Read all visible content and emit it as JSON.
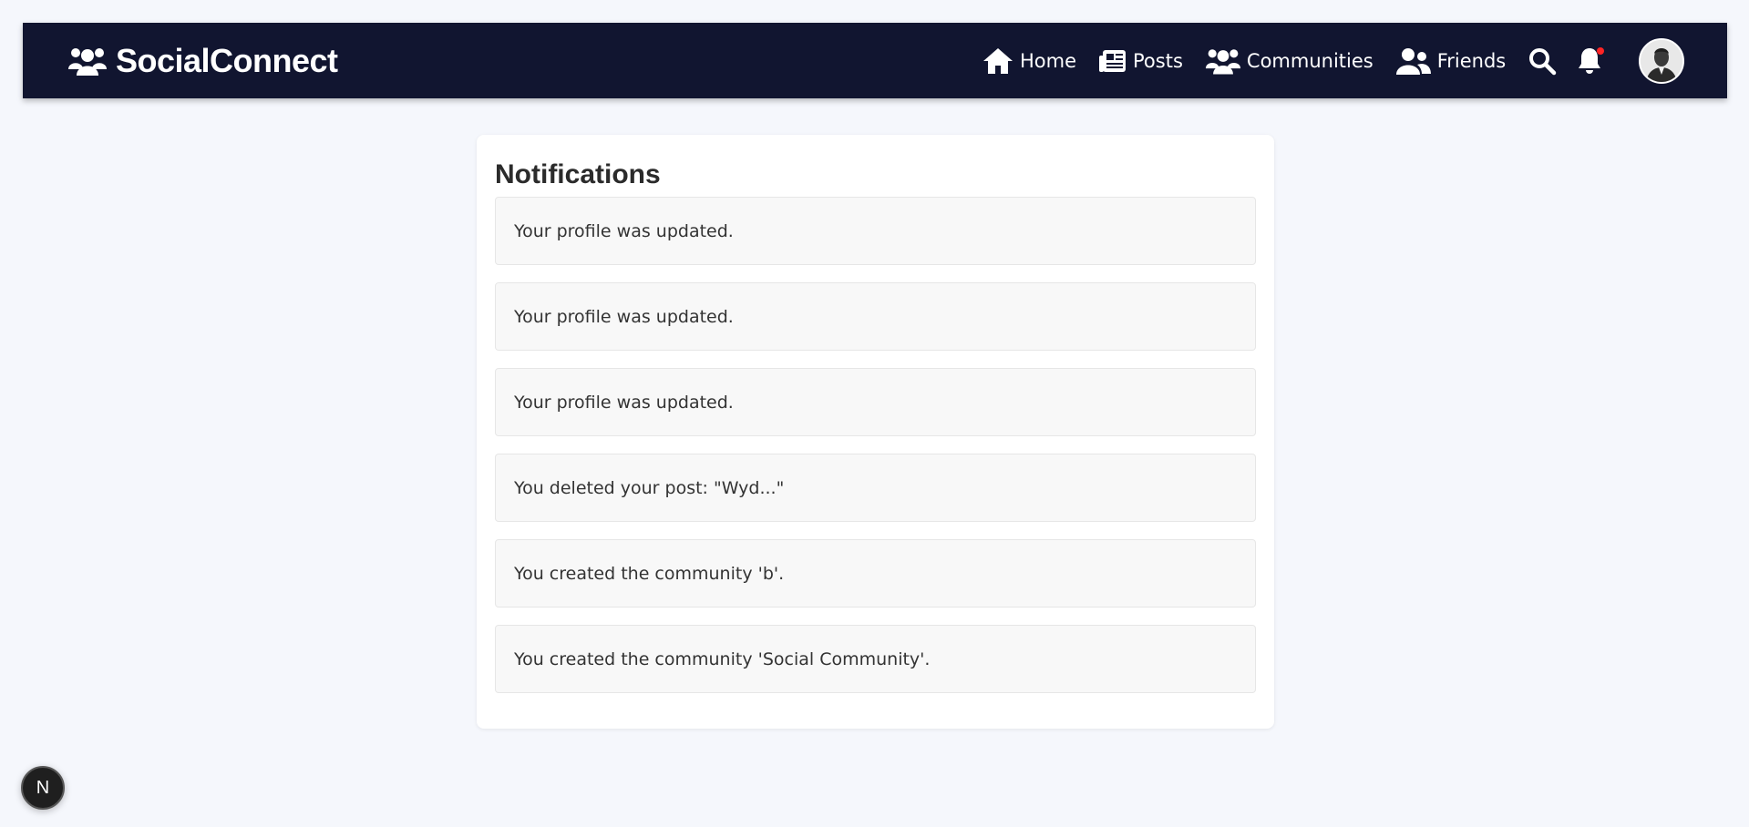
{
  "header": {
    "brand": "SocialConnect",
    "brand_icon": "users-icon",
    "nav": [
      {
        "label": "Home",
        "icon": "home-icon"
      },
      {
        "label": "Posts",
        "icon": "newspaper-icon"
      },
      {
        "label": "Communities",
        "icon": "users-icon"
      },
      {
        "label": "Friends",
        "icon": "user-friends-icon"
      }
    ],
    "search_icon": "search-icon",
    "notification_icon": "bell-icon",
    "notification_has_unread": true,
    "avatar_icon": "avatar"
  },
  "main": {
    "title": "Notifications",
    "notifications": [
      {
        "text": "Your profile was updated."
      },
      {
        "text": "Your profile was updated."
      },
      {
        "text": "Your profile was updated."
      },
      {
        "text": "You deleted your post: \"Wyd...\""
      },
      {
        "text": "You created the community 'b'."
      },
      {
        "text": "You created the community 'Social Community'."
      }
    ]
  },
  "dev_badge": {
    "label": "N"
  },
  "colors": {
    "navbar_bg": "#111530",
    "page_bg": "#f5f7fc",
    "card_bg": "#ffffff",
    "item_bg": "#f8f8f8",
    "unread_dot": "#ff2424"
  }
}
